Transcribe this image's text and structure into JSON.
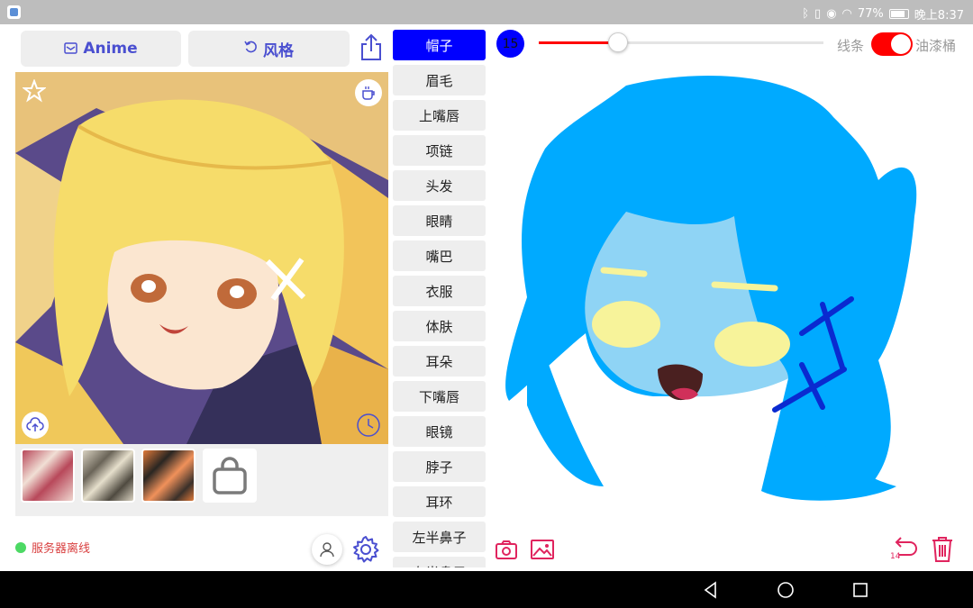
{
  "status_bar": {
    "battery": "77%",
    "time": "晚上8:37"
  },
  "top_buttons": {
    "anime_label": "Anime",
    "style_label": "风格"
  },
  "parts": {
    "selected": "帽子",
    "items": [
      "帽子",
      "眉毛",
      "上嘴唇",
      "项链",
      "头发",
      "眼睛",
      "嘴巴",
      "衣服",
      "体肤",
      "耳朵",
      "下嘴唇",
      "眼镜",
      "脖子",
      "耳环",
      "左半鼻子",
      "右半鼻子"
    ]
  },
  "brush": {
    "size": "15",
    "size_value": 15,
    "slider_fraction": 0.28,
    "color": "#0000ff"
  },
  "mode_toggle": {
    "left_label": "线条",
    "right_label": "油漆桶",
    "on": true
  },
  "server_status": "服务器离线",
  "undo_count": "14",
  "colors": {
    "accent": "#4a4fd0",
    "danger": "#e0245e",
    "hair": "#00aaff",
    "skin": "#8fd4f5",
    "eye": "#f7f39a",
    "clip": "#0a2ad0"
  }
}
